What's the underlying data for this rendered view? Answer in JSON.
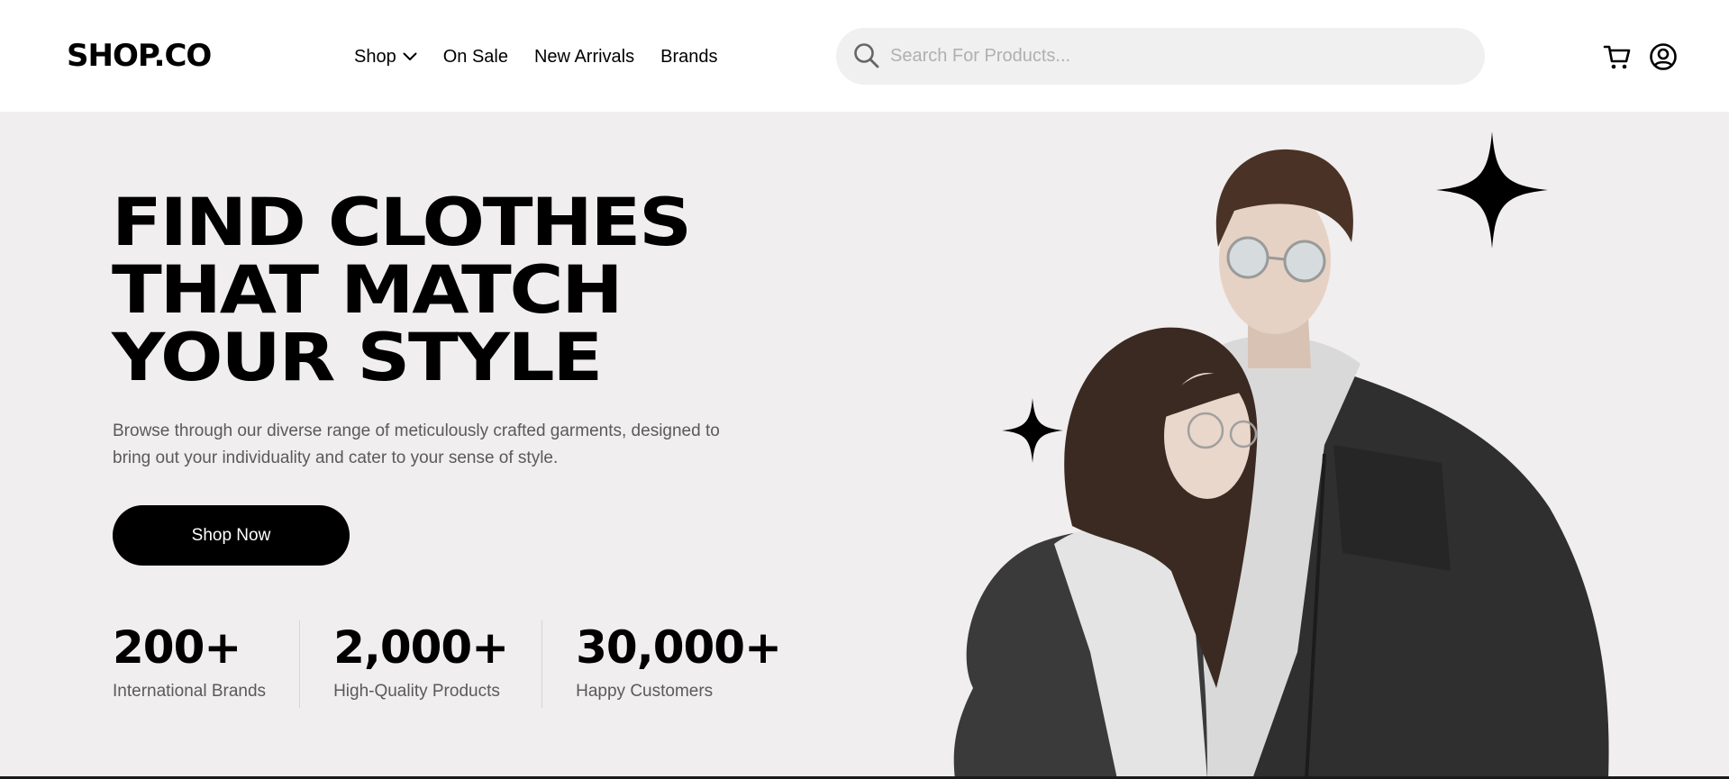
{
  "header": {
    "logo": "SHOP.CO",
    "nav": [
      {
        "label": "Shop",
        "has_dropdown": true
      },
      {
        "label": "On Sale"
      },
      {
        "label": "New Arrivals"
      },
      {
        "label": "Brands"
      }
    ],
    "search": {
      "placeholder": "Search For Products...",
      "value": ""
    },
    "icons": [
      "search-icon",
      "cart-icon",
      "account-icon",
      "chevron-down-icon"
    ]
  },
  "hero": {
    "headline": [
      "FIND CLOTHES",
      "THAT MATCH",
      "YOUR STYLE"
    ],
    "description": "Browse through our diverse range of meticulously crafted garments, designed to bring out your individuality and cater to your sense of style.",
    "cta_label": "Shop Now",
    "stats": [
      {
        "value": "200+",
        "label": "International Brands"
      },
      {
        "value": "2,000+",
        "label": "High-Quality Products"
      },
      {
        "value": "30,000+",
        "label": "Happy Customers"
      }
    ],
    "image": "couple-in-denim-jackets"
  },
  "colors": {
    "hero_background": "#f0eeee",
    "button": "#000000",
    "muted_text": "#5a5a5a",
    "search_background": "#f0f0f0"
  }
}
